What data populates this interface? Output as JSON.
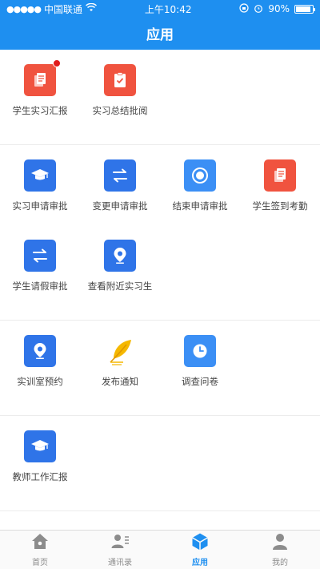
{
  "status_bar": {
    "carrier": "中国联通",
    "time": "上午10:42",
    "battery": "90%"
  },
  "header": {
    "title": "应用"
  },
  "sections": [
    {
      "rows": [
        [
          {
            "label": "学生实习汇报",
            "icon": "document-icon",
            "color": "#f0533f",
            "badge": true
          },
          {
            "label": "实习总结批阅",
            "icon": "checklist-icon",
            "color": "#f0533f"
          }
        ]
      ]
    },
    {
      "rows": [
        [
          {
            "label": "实习申请审批",
            "icon": "graduation-cap-icon",
            "color": "#2f74e8"
          },
          {
            "label": "变更申请审批",
            "icon": "swap-arrows-icon",
            "color": "#2f74e8"
          },
          {
            "label": "结束申请审批",
            "icon": "stop-circle-icon",
            "color": "#3b8ff5"
          },
          {
            "label": "学生签到考勤",
            "icon": "document-icon",
            "color": "#f0533f"
          }
        ],
        [
          {
            "label": "学生请假审批",
            "icon": "swap-arrows-icon",
            "color": "#2f74e8"
          },
          {
            "label": "查看附近实习生",
            "icon": "location-pin-icon",
            "color": "#2f74e8"
          }
        ]
      ]
    },
    {
      "rows": [
        [
          {
            "label": "实训室预约",
            "icon": "location-pin-icon",
            "color": "#2f74e8"
          },
          {
            "label": "发布通知",
            "icon": "feather-pen-icon",
            "color": "#f5b800"
          },
          {
            "label": "调查问卷",
            "icon": "clock-icon",
            "color": "#3b8ff5"
          }
        ]
      ]
    },
    {
      "rows": [
        [
          {
            "label": "教师工作汇报",
            "icon": "graduation-cap-icon",
            "color": "#2f74e8"
          }
        ]
      ]
    }
  ],
  "tabbar": {
    "active_color": "#1e8ff0",
    "tabs": [
      {
        "label": "首页",
        "icon": "home-icon",
        "active": false
      },
      {
        "label": "通讯录",
        "icon": "contacts-icon",
        "active": false
      },
      {
        "label": "应用",
        "icon": "cube-icon",
        "active": true
      },
      {
        "label": "我的",
        "icon": "person-icon",
        "active": false
      }
    ]
  }
}
